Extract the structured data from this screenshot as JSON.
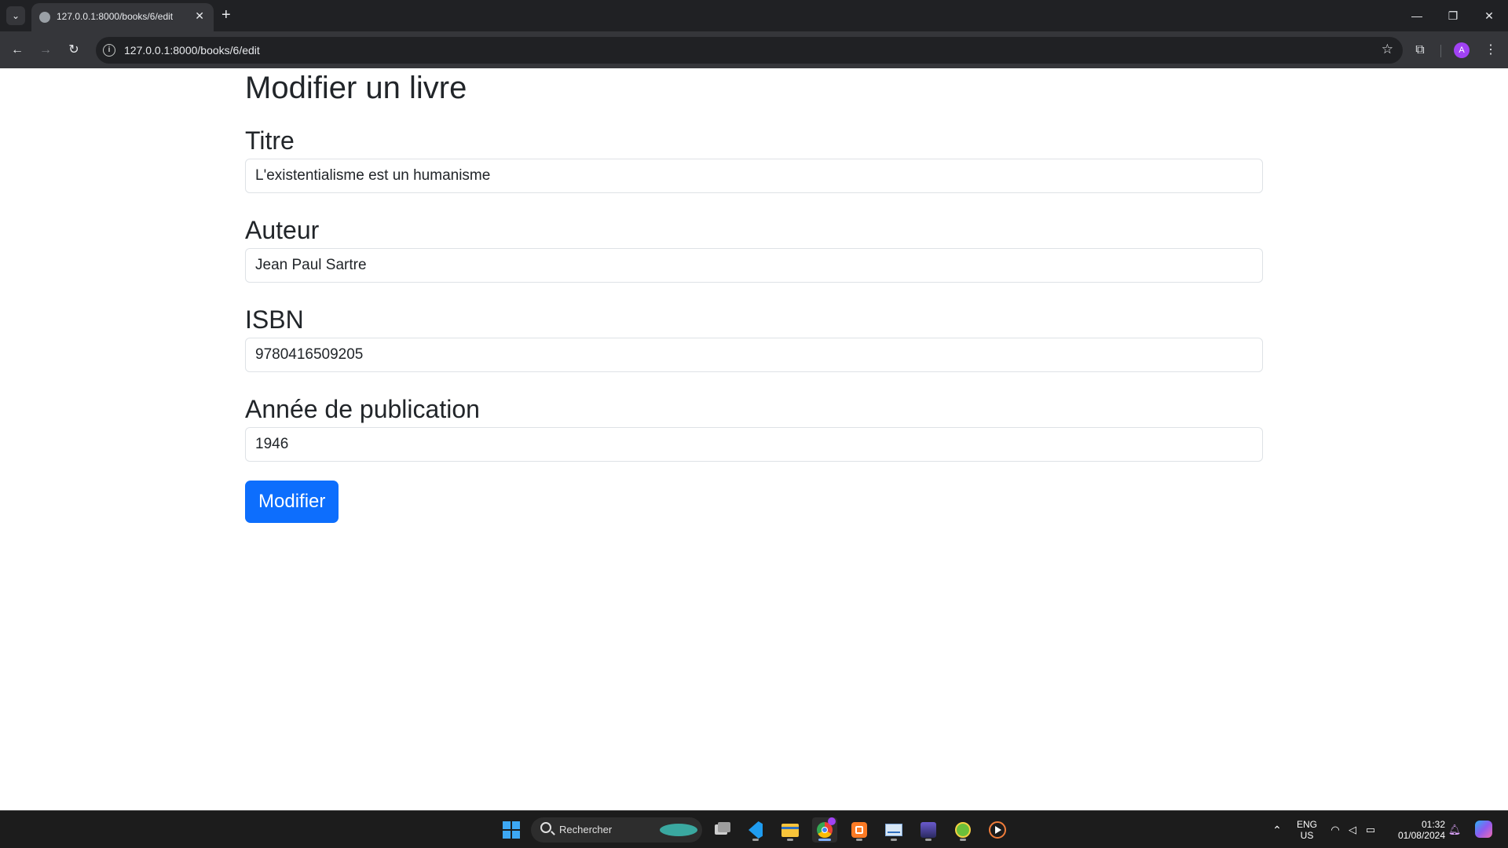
{
  "browser": {
    "tab_title": "127.0.0.1:8000/books/6/edit",
    "url": "127.0.0.1:8000/books/6/edit",
    "profile_initial": "A"
  },
  "page": {
    "title": "Modifier un livre",
    "fields": [
      {
        "label": "Titre",
        "value": "L'existentialisme est un humanisme"
      },
      {
        "label": "Auteur",
        "value": "Jean Paul Sartre"
      },
      {
        "label": "ISBN",
        "value": "9780416509205"
      },
      {
        "label": "Année de publication",
        "value": "1946"
      }
    ],
    "submit_label": "Modifier"
  },
  "taskbar": {
    "search_placeholder": "Rechercher",
    "language_line1": "ENG",
    "language_line2": "US",
    "time": "01:32",
    "date": "01/08/2024",
    "apps": [
      "task-view",
      "vscode",
      "file-explorer",
      "chrome",
      "xampp",
      "resource-monitor",
      "app-generic",
      "app-green",
      "media-player"
    ]
  },
  "colors": {
    "primary_button": "#0d6efd",
    "chrome_dark": "#202124",
    "chrome_toolbar": "#35363a",
    "taskbar": "#1c1c1c"
  }
}
